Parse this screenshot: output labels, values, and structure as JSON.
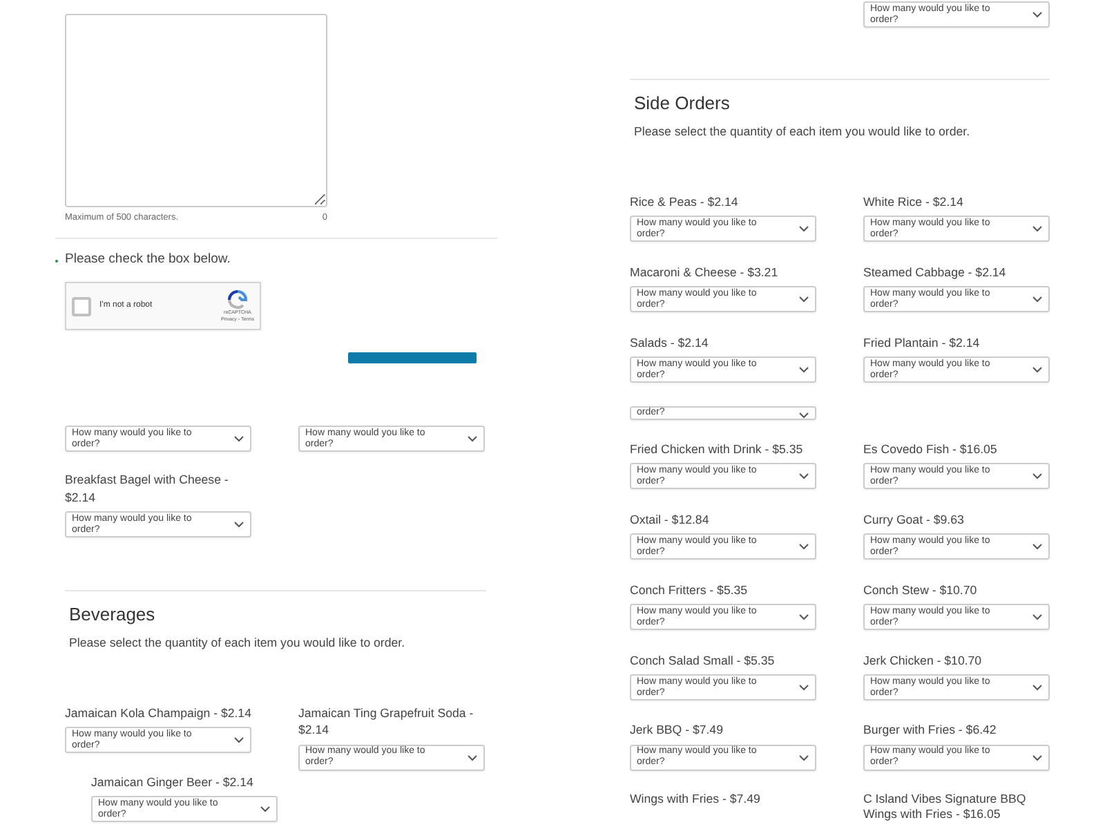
{
  "left": {
    "instructions": {
      "note": "Maximum of 500 characters.",
      "count": "0"
    },
    "captcha": {
      "prompt": "Please check the box below.",
      "checkbox_label": "I'm not a robot",
      "brand": "reCAPTCHA",
      "links": "Privacy - Terms",
      "checked": false
    },
    "loose_dropdowns": [
      {
        "placeholder": "How many would you like to order?"
      },
      {
        "placeholder": "How many would you like to order?"
      }
    ],
    "items": [
      {
        "label": "Breakfast Bagel with Cheese - $2.14",
        "placeholder": "How many would you like to order?"
      }
    ],
    "beverages": {
      "title": "Beverages",
      "subtitle": "Please select the quantity of each item you would like to order.",
      "items": [
        {
          "label": "Jamaican Kola Champaign - $2.14",
          "placeholder": "How many would you like to order?"
        },
        {
          "label": "Jamaican Ting Grapefruit Soda - $2.14",
          "placeholder": "How many would you like to order?"
        },
        {
          "label": "Jamaican Ginger Beer - $2.14",
          "placeholder": "How many would you like to order?"
        }
      ]
    }
  },
  "right": {
    "top_dropdown": {
      "placeholder": "How many would you like to order?"
    },
    "side_orders": {
      "title": "Side Orders",
      "subtitle": "Please select the quantity of each item you would like to order.",
      "items": [
        {
          "kind": "full",
          "label": "Rice & Peas - $2.14",
          "placeholder": "How many would you like to order?"
        },
        {
          "kind": "full",
          "label": "White Rice - $2.14",
          "placeholder": "How many would you like to order?"
        },
        {
          "kind": "full",
          "label": "Macaroni & Cheese - $3.21",
          "placeholder": "How many would you like to order?"
        },
        {
          "kind": "full",
          "label": "Steamed Cabbage - $2.14",
          "placeholder": "How many would you like to order?"
        },
        {
          "kind": "full",
          "label": "Salads - $2.14",
          "placeholder": "How many would you like to order?"
        },
        {
          "kind": "full",
          "label": "Fried Plantain - $2.14",
          "placeholder": "How many would you like to order?"
        },
        {
          "kind": "clipped",
          "placeholder": "order?"
        },
        {
          "kind": "full",
          "label": "Fried Chicken with Drink - $5.35",
          "placeholder": "How many would you like to order?"
        },
        {
          "kind": "full",
          "label": "Es Covedo Fish - $16.05",
          "placeholder": "How many would you like to order?"
        },
        {
          "kind": "full",
          "label": "Oxtail - $12.84",
          "placeholder": "How many would you like to order?"
        },
        {
          "kind": "full",
          "label": "Curry Goat - $9.63",
          "placeholder": "How many would you like to order?"
        },
        {
          "kind": "full",
          "label": "Conch Fritters - $5.35",
          "placeholder": "How many would you like to order?"
        },
        {
          "kind": "full",
          "label": "Conch Stew - $10.70",
          "placeholder": "How many would you like to order?"
        },
        {
          "kind": "full",
          "label": "Conch Salad Small - $5.35",
          "placeholder": "How many would you like to order?"
        },
        {
          "kind": "full",
          "label": "Jerk Chicken - $10.70",
          "placeholder": "How many would you like to order?"
        },
        {
          "kind": "full",
          "label": "Jerk BBQ - $7.49",
          "placeholder": "How many would you like to order?"
        },
        {
          "kind": "full",
          "label": "Burger with Fries - $6.42",
          "placeholder": "How many would you like to order?"
        },
        {
          "kind": "label_only",
          "label": "Wings with Fries - $7.49"
        },
        {
          "kind": "label_only",
          "label": "C Island Vibes Signature BBQ Wings with Fries - $16.05"
        }
      ]
    }
  }
}
